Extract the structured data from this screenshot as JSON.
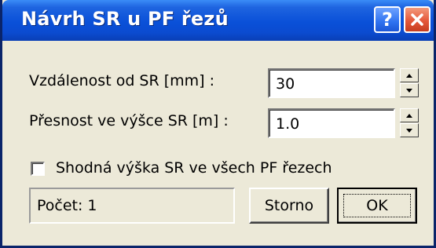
{
  "window": {
    "title": "Návrh SR u PF řezů",
    "help_glyph": "?",
    "close_icon": "close-icon"
  },
  "form": {
    "distance": {
      "label": "Vzdálenost od SR  [mm] :",
      "value": "30"
    },
    "precision": {
      "label": "Přesnost ve výšce SR [m] :",
      "value": "1.0"
    },
    "same_height": {
      "label": "Shodná výška SR ve všech PF řezech",
      "checked": false
    }
  },
  "status": {
    "text": "Počet: 1"
  },
  "buttons": {
    "cancel": "Storno",
    "ok": "OK"
  },
  "colors": {
    "titlebar": "#0a50d8",
    "dialog_bg": "#ece9d8",
    "close_button": "#e5583a"
  }
}
